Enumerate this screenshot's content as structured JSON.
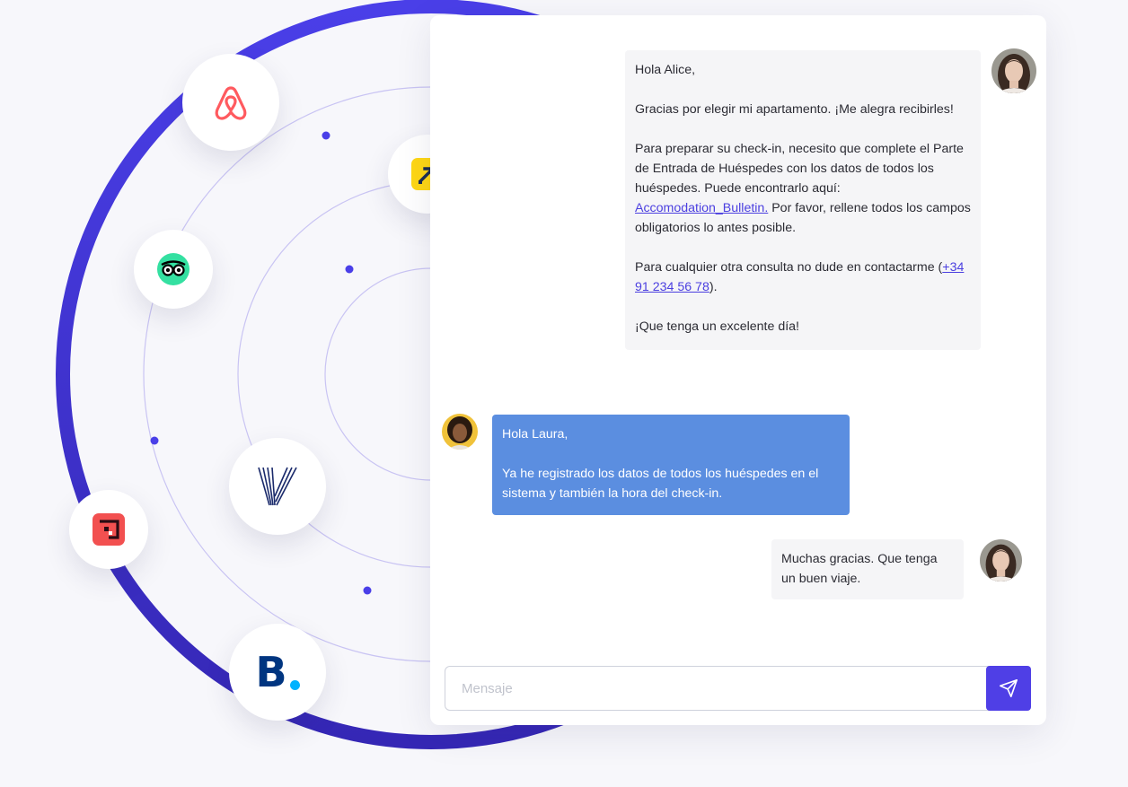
{
  "colors": {
    "accent": "#4f3fe6",
    "guest_bubble": "#5b8ee0",
    "host_bubble": "#f5f5f7",
    "link": "#4b3fe0",
    "airbnb": "#ff5a5f",
    "expedia": "#ffd814",
    "tripadvisor": "#34e0a1",
    "hostelworld": "#f25050",
    "booking": "#003580",
    "booking_dot": "#00b2ff"
  },
  "platforms": [
    {
      "name": "airbnb",
      "icon": "airbnb-icon"
    },
    {
      "name": "expedia",
      "icon": "expedia-icon"
    },
    {
      "name": "tripadvisor",
      "icon": "tripadvisor-icon"
    },
    {
      "name": "vrbo",
      "icon": "vrbo-icon"
    },
    {
      "name": "hostelworld",
      "icon": "hostelworld-icon"
    },
    {
      "name": "booking",
      "icon": "booking-icon"
    }
  ],
  "booking_logo_text": "B",
  "messages": {
    "host_1": {
      "greeting": "Hola Alice,",
      "thanks": "Gracias por elegir mi apartamento. ¡Me alegra recibirles!",
      "checkin_before": "Para preparar su check-in, necesito que complete el Parte de Entrada de Huéspedes con los datos de todos los huéspedes. Puede encontrarlo aquí: ",
      "checkin_link": "Accomodation_Bulletin.",
      "checkin_after": " Por favor, rellene todos los campos obligatorios lo antes posible.",
      "contact_before": "Para cualquier otra consulta no dude en contactarme (",
      "contact_link": "+34 91 234 56 78",
      "contact_after": ").",
      "closing": "¡Que tenga un excelente día!"
    },
    "guest_1": {
      "greeting": "Hola Laura,",
      "body": "Ya he registrado los datos de todos los huéspedes en el sistema y también la hora del check-in."
    },
    "host_2": {
      "body": "Muchas gracias. Que tenga un buen viaje."
    }
  },
  "composer": {
    "placeholder": "Mensaje",
    "send_icon": "send-icon"
  }
}
